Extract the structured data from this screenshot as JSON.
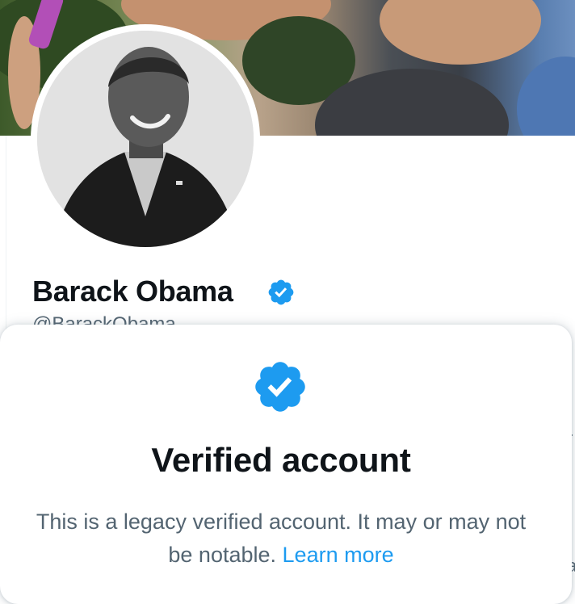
{
  "profile": {
    "display_name": "Barack Obama",
    "handle": "@BarackObama"
  },
  "side_fragments": {
    "a": "r",
    "b": "a"
  },
  "verified_card": {
    "title": "Verified account",
    "description": "This is a legacy verified account. It may or may not be notable.",
    "link_label": "Learn more"
  },
  "icons": {
    "verified_badge": "verified-badge-icon"
  },
  "colors": {
    "badge_blue": "#1d9bf0",
    "text_primary": "#0f1419",
    "text_secondary": "#536471",
    "link": "#1d9bf0"
  }
}
